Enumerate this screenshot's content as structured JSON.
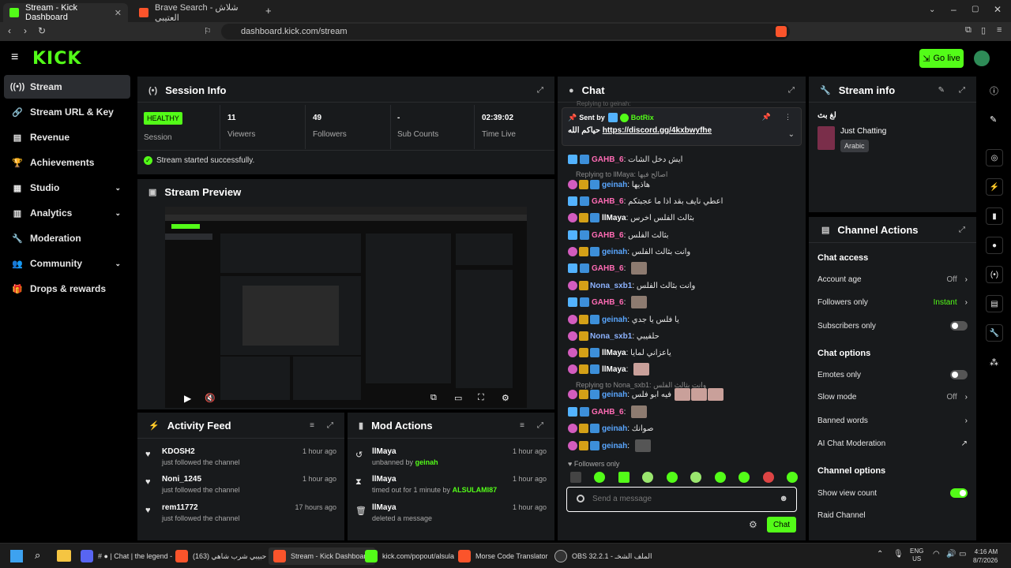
{
  "browser": {
    "tabs": [
      {
        "title": "Stream - Kick Dashboard"
      },
      {
        "title": "Brave Search - شلاش العتيبي"
      }
    ],
    "new_tab": "+",
    "url": "dashboard.kick.com/stream"
  },
  "header": {
    "logo": "KICK",
    "go_live": "Go live"
  },
  "sidebar": {
    "items": [
      {
        "label": "Stream",
        "icon": "broadcast-icon"
      },
      {
        "label": "Stream URL & Key",
        "icon": "link-icon"
      },
      {
        "label": "Revenue",
        "icon": "chart-icon"
      },
      {
        "label": "Achievements",
        "icon": "trophy-icon"
      },
      {
        "label": "Studio",
        "icon": "studio-icon",
        "chevron": "⌄"
      },
      {
        "label": "Analytics",
        "icon": "analytics-icon",
        "chevron": "⌄"
      },
      {
        "label": "Moderation",
        "icon": "wrench-icon"
      },
      {
        "label": "Community",
        "icon": "people-icon",
        "chevron": "⌄"
      },
      {
        "label": "Drops & rewards",
        "icon": "gift-icon"
      }
    ]
  },
  "session": {
    "title": "Session Info",
    "status": "HEALTHY",
    "status_label": "Session",
    "stats": [
      {
        "value": "11",
        "label": "Viewers"
      },
      {
        "value": "49",
        "label": "Followers"
      },
      {
        "value": "-",
        "label": "Sub Counts"
      },
      {
        "value": "02:39:02",
        "label": "Time Live"
      }
    ],
    "message": "Stream started successfully."
  },
  "preview": {
    "title": "Stream Preview"
  },
  "activity": {
    "title": "Activity Feed",
    "items": [
      {
        "name": "KDOSH2",
        "desc": "just followed the channel",
        "time": "1 hour ago"
      },
      {
        "name": "Noni_1245",
        "desc": "just followed the channel",
        "time": "1 hour ago"
      },
      {
        "name": "rem11772",
        "desc": "just followed the channel",
        "time": "17 hours ago"
      }
    ]
  },
  "mod": {
    "title": "Mod Actions",
    "items": [
      {
        "name": "llMaya",
        "desc": "unbanned by",
        "by": "geinah",
        "time": "1 hour ago"
      },
      {
        "name": "llMaya",
        "desc": "timed out for 1 minute by",
        "by": "ALSULAMI87",
        "time": "1 hour ago"
      },
      {
        "name": "llMaya",
        "desc": "deleted a message",
        "by": "",
        "time": "1 hour ago"
      }
    ]
  },
  "chat": {
    "title": "Chat",
    "top_reply": "Replying to geinah:",
    "pinned_label": "Sent by",
    "pinned_user": "BotRix",
    "pinned_msg": "حياكم الله",
    "pinned_link": "https://discord.gg/4kxbwyfhe",
    "lines": [
      {
        "user": "GAHB_6",
        "color": "#ff6bb4",
        "msg": "ايش دخل الشات"
      },
      {
        "reply": "Replying to llMaya: اصالح فيها"
      },
      {
        "user": "geinah",
        "color": "#5aa7ff",
        "msg": "هاذيها"
      },
      {
        "user": "GAHB_6",
        "color": "#ff6bb4",
        "msg": "اعطي نايف بقد اذا ما عجبتكم"
      },
      {
        "user": "llMaya",
        "color": "#ffffff",
        "msg": "بثالث الفلس اخرس"
      },
      {
        "user": "GAHB_6",
        "color": "#ff6bb4",
        "msg": "بثالث الفلس"
      },
      {
        "user": "geinah",
        "color": "#5aa7ff",
        "msg": "وانت بثالث الفلس"
      },
      {
        "user": "GAHB_6",
        "color": "#ff6bb4",
        "msg": ""
      },
      {
        "user": "Nona_sxb1",
        "color": "#8db3ff",
        "msg": "وانت بثالث الفلس"
      },
      {
        "user": "GAHB_6",
        "color": "#ff6bb4",
        "msg": ""
      },
      {
        "user": "geinah",
        "color": "#5aa7ff",
        "msg": "يا فلس يا جدي"
      },
      {
        "user": "Nona_sxb1",
        "color": "#8db3ff",
        "msg": "حلفيبي"
      },
      {
        "user": "llMaya",
        "color": "#ffffff",
        "msg": "ياعزاني لمايا"
      },
      {
        "user": "llMaya",
        "color": "#ffffff",
        "msg": ""
      },
      {
        "reply": "Replying to Nona_sxb1: وانت بثالث الفلس"
      },
      {
        "user": "geinah",
        "color": "#5aa7ff",
        "msg": "فيه ابو فلس"
      },
      {
        "user": "GAHB_6",
        "color": "#ff6bb4",
        "msg": ""
      },
      {
        "user": "geinah",
        "color": "#5aa7ff",
        "msg": "صوانك"
      },
      {
        "user": "geinah",
        "color": "#5aa7ff",
        "msg": ""
      }
    ],
    "followers_only": "Followers only",
    "input_placeholder": "Send a message",
    "send": "Chat"
  },
  "stream_info": {
    "title": "Stream info",
    "stream_title": "لغ بث",
    "category": "Just Chatting",
    "language": "Arabic"
  },
  "channel_actions": {
    "title": "Channel Actions",
    "sections": [
      {
        "heading": "Chat access",
        "items": [
          {
            "label": "Account age",
            "value": "Off",
            "type": "arrow"
          },
          {
            "label": "Followers only",
            "value": "Instant",
            "type": "arrow"
          },
          {
            "label": "Subscribers only",
            "value": "",
            "type": "toggle-off"
          }
        ]
      },
      {
        "heading": "Chat options",
        "items": [
          {
            "label": "Emotes only",
            "value": "",
            "type": "toggle-off"
          },
          {
            "label": "Slow mode",
            "value": "Off",
            "type": "arrow"
          },
          {
            "label": "Banned words",
            "value": "",
            "type": "arrow"
          },
          {
            "label": "AI Chat Moderation",
            "value": "",
            "type": "external"
          }
        ]
      },
      {
        "heading": "Channel options",
        "items": [
          {
            "label": "Show view count",
            "value": "",
            "type": "toggle-on"
          },
          {
            "label": "Raid Channel",
            "value": "",
            "type": "none"
          }
        ]
      }
    ]
  },
  "taskbar": {
    "items": [
      {
        "label": "# ● | Chat | the legend -",
        "color": "#5865f2"
      },
      {
        "label": "(163) حبيبي شرب شاهي",
        "color": "#fb542b"
      },
      {
        "label": "Stream - Kick Dashboard",
        "color": "#fb542b"
      },
      {
        "label": "kick.com/popout/alsula",
        "color": "#53fc18"
      },
      {
        "label": "Morse Code Translator",
        "color": "#fb542b"
      },
      {
        "label": "OBS 32.2.1 - الملف الشخـ",
        "color": "#333333"
      }
    ],
    "lang": "ENG",
    "region": "US",
    "time": "4:16 AM",
    "date": "8/7/2026"
  }
}
